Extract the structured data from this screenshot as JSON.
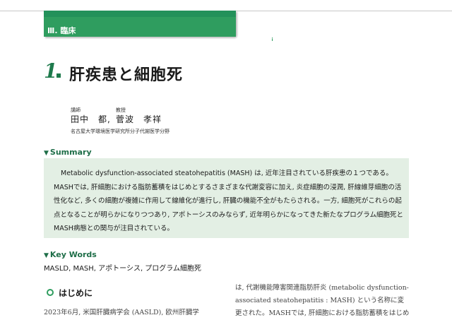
{
  "section": {
    "label": "Ⅲ. 臨床",
    "page_icon": "i"
  },
  "article": {
    "number": "1",
    "title": "肝疾患と細胞死"
  },
  "authors": [
    {
      "role": "講師",
      "name": "田中　都,"
    },
    {
      "role": "教授",
      "name": "菅波　孝祥"
    }
  ],
  "affiliation": "名古屋大学環境医学研究所分子代謝医学分野",
  "summary": {
    "heading": "Summary",
    "text": "Metabolic dysfunction-associated steatohepatitis (MASH) は, 近年注目されている肝疾患の１つである。MASHでは, 肝細胞における脂肪蓄積をはじめとするさまざまな代謝変容に加え, 炎症細胞の浸潤, 肝線維芽細胞の活性化など, 多くの細胞が複雑に作用して線維化が進行し, 肝臓の機能不全がもたらされる。一方, 細胞死がこれらの起点となることが明らかになりつつあり, アポトーシスのみならず, 近年明らかになってきた新たなプログラム細胞死とMASH病態との関与が注目されている。"
  },
  "keywords": {
    "heading": "Key Words",
    "text": "MASLD, MASH, アポトーシス, プログラム細胞死"
  },
  "intro": {
    "heading": "はじめに",
    "left_text": "2023年6月, 米国肝臓病学会 (AASLD), 欧州肝臓学",
    "right_text": "は, 代謝機能障害関連脂肪肝炎 (metabolic dysfunction-associated steatohepatitis : MASH) という名称に変更された。MASHでは, 肝細胞における脂肪蓄積をはじめ"
  },
  "colors": {
    "accent_green": "#2f9d5f",
    "heading_green": "#1e6e48",
    "summary_bg": "#e3efe4"
  }
}
